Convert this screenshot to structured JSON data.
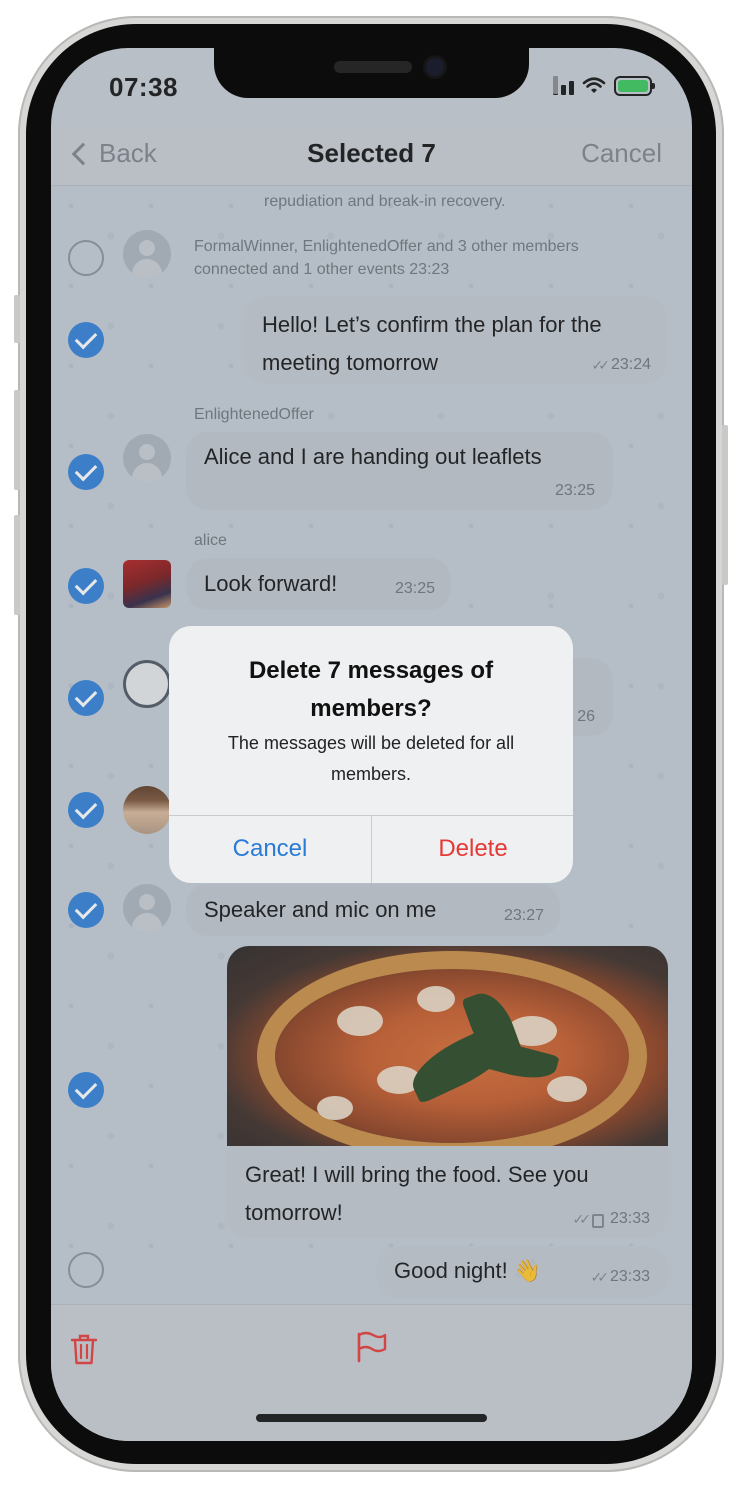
{
  "status_bar": {
    "time": "07:38"
  },
  "nav": {
    "back_label": "Back",
    "title": "Selected 7",
    "cancel_label": "Cancel"
  },
  "chat": {
    "system_top": "repudiation and break-in recovery.",
    "system_event": "FormalWinner, EnlightenedOffer and 3 other members connected and 1 other events 23:23",
    "messages": [
      {
        "text": "Hello! Let’s confirm the plan for the meeting tomorrow",
        "time": "23:24",
        "selected": true
      },
      {
        "sender": "EnlightenedOffer",
        "text": "Alice and I are handing out leaflets",
        "time": "23:25",
        "selected": true
      },
      {
        "sender": "alice",
        "text": "Look forward!",
        "time": "23:25",
        "selected": true
      },
      {
        "time": "26",
        "selected": true
      },
      {
        "selected": true
      },
      {
        "text": "Speaker and mic on me",
        "time": "23:27",
        "selected": true
      },
      {
        "text": "Great! I will bring the food. See you tomorrow!",
        "time": "23:33",
        "selected": true
      },
      {
        "text": "Good night! 👋",
        "time": "23:33",
        "selected": false
      }
    ]
  },
  "alert": {
    "title": "Delete 7 messages of members?",
    "message": "The messages will be deleted for all members.",
    "cancel_label": "Cancel",
    "delete_label": "Delete"
  },
  "colors": {
    "accent": "#2a7bd6",
    "destructive": "#e53935",
    "check": "#2f7fd6"
  },
  "toolbar": {
    "icons": [
      "trash-icon",
      "flag-icon"
    ]
  }
}
